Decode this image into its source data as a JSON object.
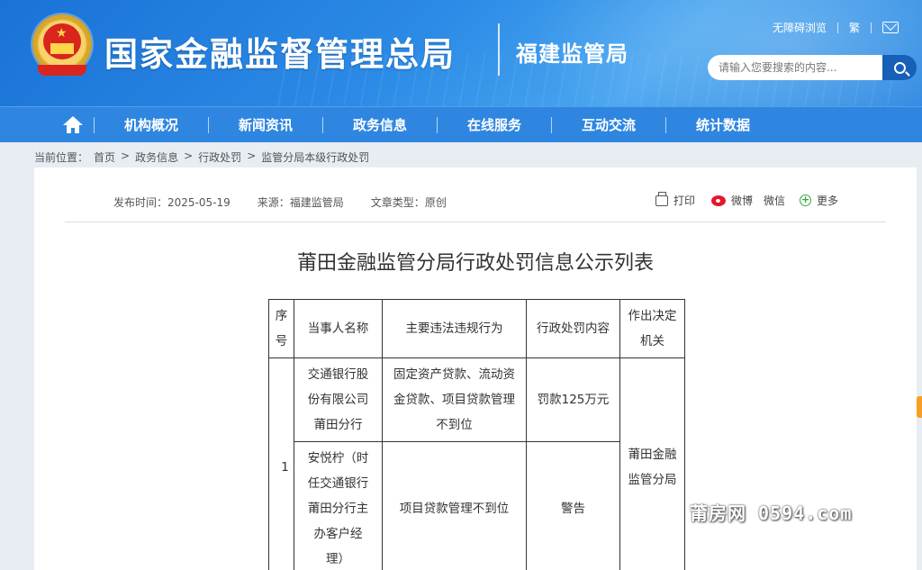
{
  "header": {
    "site_title": "国家金融监督管理总局",
    "branch_title": "福建监管局",
    "util_links": {
      "accessible": "无障碍浏览",
      "traditional": "繁"
    },
    "search": {
      "placeholder": "请输入您要搜索的内容..."
    }
  },
  "nav": {
    "items": [
      "机构概况",
      "新闻资讯",
      "政务信息",
      "在线服务",
      "互动交流",
      "统计数据"
    ]
  },
  "breadcrumb": {
    "label": "当前位置：",
    "items": [
      "首页",
      "政务信息",
      "行政处罚",
      "监管分局本级行政处罚"
    ],
    "separator": ">"
  },
  "article": {
    "publish_label": "发布时间：",
    "publish_date": "2025-05-19",
    "source_label": "来源：",
    "source": "福建监管局",
    "type_label": "文章类型：",
    "type": "原创",
    "share": {
      "print": "打印",
      "weibo": "微博",
      "wechat": "微信",
      "more": "更多"
    },
    "title": "莆田金融监管分局行政处罚信息公示列表"
  },
  "table": {
    "headers": {
      "no": "序号",
      "party": "当事人名称",
      "act": "主要违法违规行为",
      "penalty": "行政处罚内容",
      "org": "作出决定机关"
    },
    "rows": [
      {
        "no": "1",
        "party": "交通银行股份有限公司莆田分行",
        "act": "固定资产贷款、流动资金贷款、项目贷款管理不到位",
        "penalty": "罚款125万元",
        "org": "莆田金融监管分局"
      },
      {
        "party": "安悦柠（时任交通银行莆田分行主办客户经理）",
        "act": "项目贷款管理不到位",
        "penalty": "警告"
      }
    ]
  },
  "watermark": "莆房网 0594.com"
}
